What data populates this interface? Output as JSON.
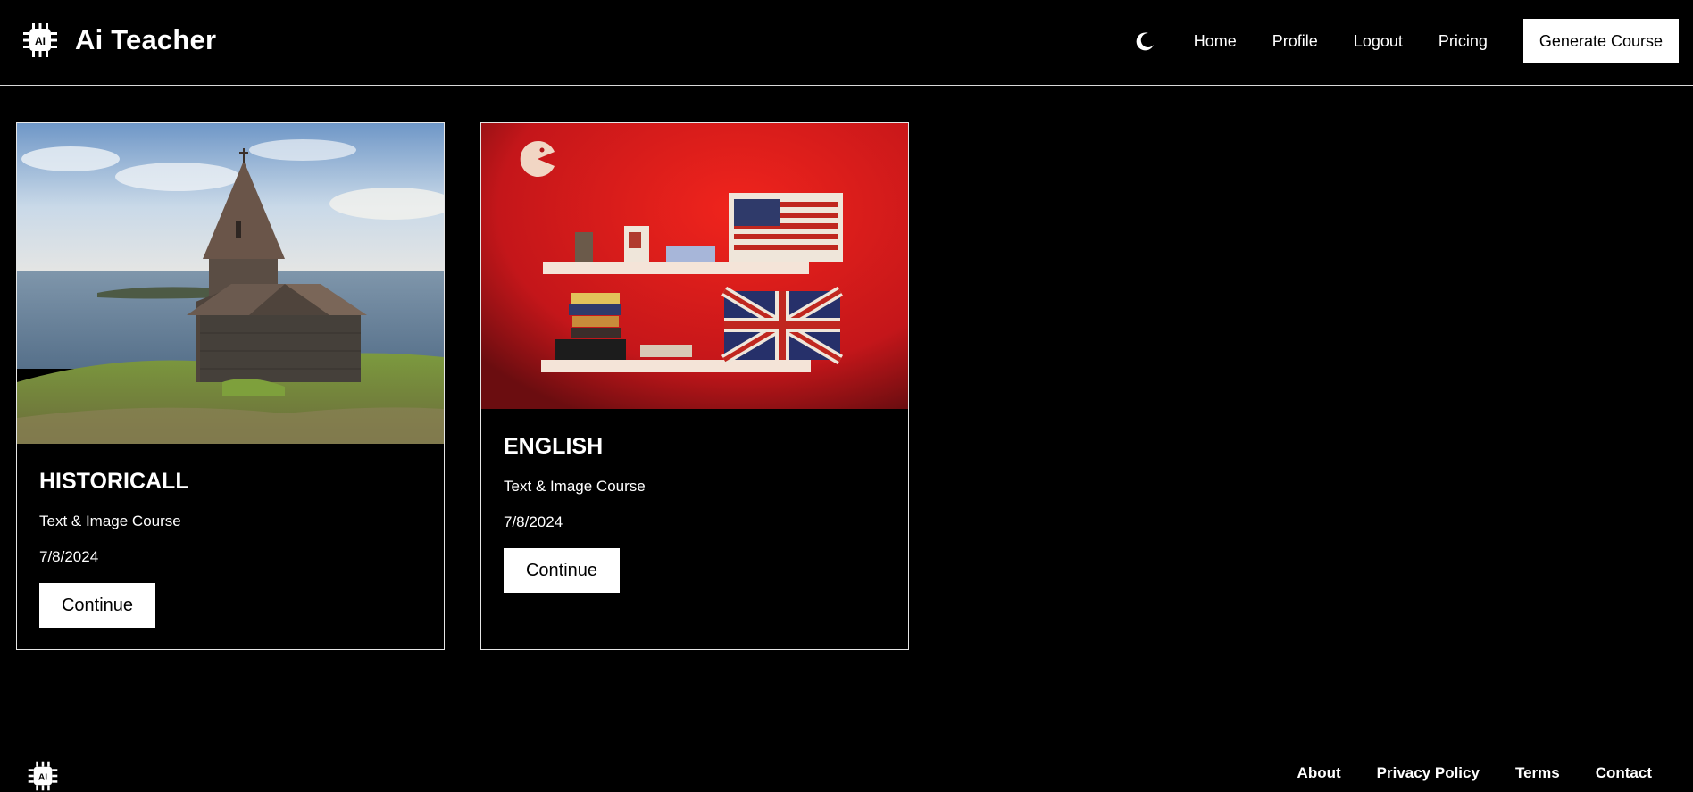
{
  "header": {
    "app_name": "Ai Teacher",
    "logo_icon": "ai-chip-icon",
    "theme_icon": "moon-icon",
    "nav": [
      "Home",
      "Profile",
      "Logout",
      "Pricing"
    ],
    "generate_label": "Generate Course"
  },
  "courses": [
    {
      "title": "HISTORICALL",
      "type": "Text & Image Course",
      "date": "7/8/2024",
      "button": "Continue",
      "image": "church-by-lake-photo"
    },
    {
      "title": "ENGLISH",
      "type": "Text & Image Course",
      "date": "7/8/2024",
      "button": "Continue",
      "image": "red-wall-shelves-flags-photo"
    }
  ],
  "footer": {
    "logo_icon": "ai-chip-icon",
    "links": [
      "About",
      "Privacy Policy",
      "Terms",
      "Contact"
    ]
  }
}
